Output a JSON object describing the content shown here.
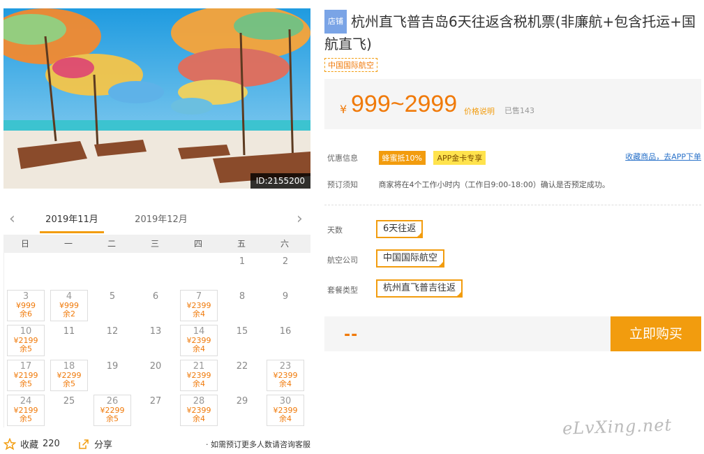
{
  "hero": {
    "id_badge": "ID:2155200"
  },
  "calendar": {
    "months": [
      "2019年11月",
      "2019年12月"
    ],
    "active_month_index": 0,
    "weekdays": [
      "日",
      "一",
      "二",
      "三",
      "四",
      "五",
      "六"
    ],
    "cells": [
      {
        "day": ""
      },
      {
        "day": ""
      },
      {
        "day": ""
      },
      {
        "day": ""
      },
      {
        "day": ""
      },
      {
        "day": "1"
      },
      {
        "day": "2"
      },
      {
        "day": "3",
        "price": "¥999",
        "left": "余6"
      },
      {
        "day": "4",
        "price": "¥999",
        "left": "余2"
      },
      {
        "day": "5"
      },
      {
        "day": "6"
      },
      {
        "day": "7",
        "price": "¥2399",
        "left": "余4"
      },
      {
        "day": "8"
      },
      {
        "day": "9"
      },
      {
        "day": "10",
        "price": "¥2199",
        "left": "余5"
      },
      {
        "day": "11"
      },
      {
        "day": "12"
      },
      {
        "day": "13"
      },
      {
        "day": "14",
        "price": "¥2399",
        "left": "余4"
      },
      {
        "day": "15"
      },
      {
        "day": "16"
      },
      {
        "day": "17",
        "price": "¥2199",
        "left": "余5"
      },
      {
        "day": "18",
        "price": "¥2299",
        "left": "余5"
      },
      {
        "day": "19"
      },
      {
        "day": "20"
      },
      {
        "day": "21",
        "price": "¥2399",
        "left": "余4"
      },
      {
        "day": "22"
      },
      {
        "day": "23",
        "price": "¥2399",
        "left": "余4"
      },
      {
        "day": "24",
        "price": "¥2199",
        "left": "余5"
      },
      {
        "day": "25"
      },
      {
        "day": "26",
        "price": "¥2299",
        "left": "余5"
      },
      {
        "day": "27"
      },
      {
        "day": "28",
        "price": "¥2399",
        "left": "余4"
      },
      {
        "day": "29"
      },
      {
        "day": "30",
        "price": "¥2399",
        "left": "余4"
      }
    ]
  },
  "bottom_bar": {
    "fav_label": "收藏",
    "fav_count": "220",
    "share_label": "分享",
    "note": "· 如需预订更多人数请咨询客服"
  },
  "product": {
    "shop_tag": "店铺",
    "title": "杭州直飞普吉岛6天往返含税机票(非廉航+包含托运+国航直飞)",
    "airline_tag": "中国国际航空",
    "currency": "¥",
    "price_range": "999~2999",
    "price_explain": "价格说明",
    "sold": "已售143",
    "promo_label": "优惠信息",
    "promo_a": "蜂蜜抵10%",
    "promo_b": "APP金卡专享",
    "fav_link": "收藏商品，去APP下单",
    "notice_label": "预订须知",
    "notice_text": "商家将在4个工作小时内（工作日9:00-18:00）确认是否预定成功。"
  },
  "options": [
    {
      "label": "天数",
      "value": "6天往返"
    },
    {
      "label": "航空公司",
      "value": "中国国际航空"
    },
    {
      "label": "套餐类型",
      "value": "杭州直飞普吉往返"
    }
  ],
  "buy": {
    "total_placeholder": "--",
    "button_label": "立即购买"
  },
  "watermark": "eLvXing.net",
  "colors": {
    "accent": "#f29c0e",
    "price": "#f07a0a",
    "link": "#2a72c9",
    "shop_tag": "#7aa4e6"
  }
}
